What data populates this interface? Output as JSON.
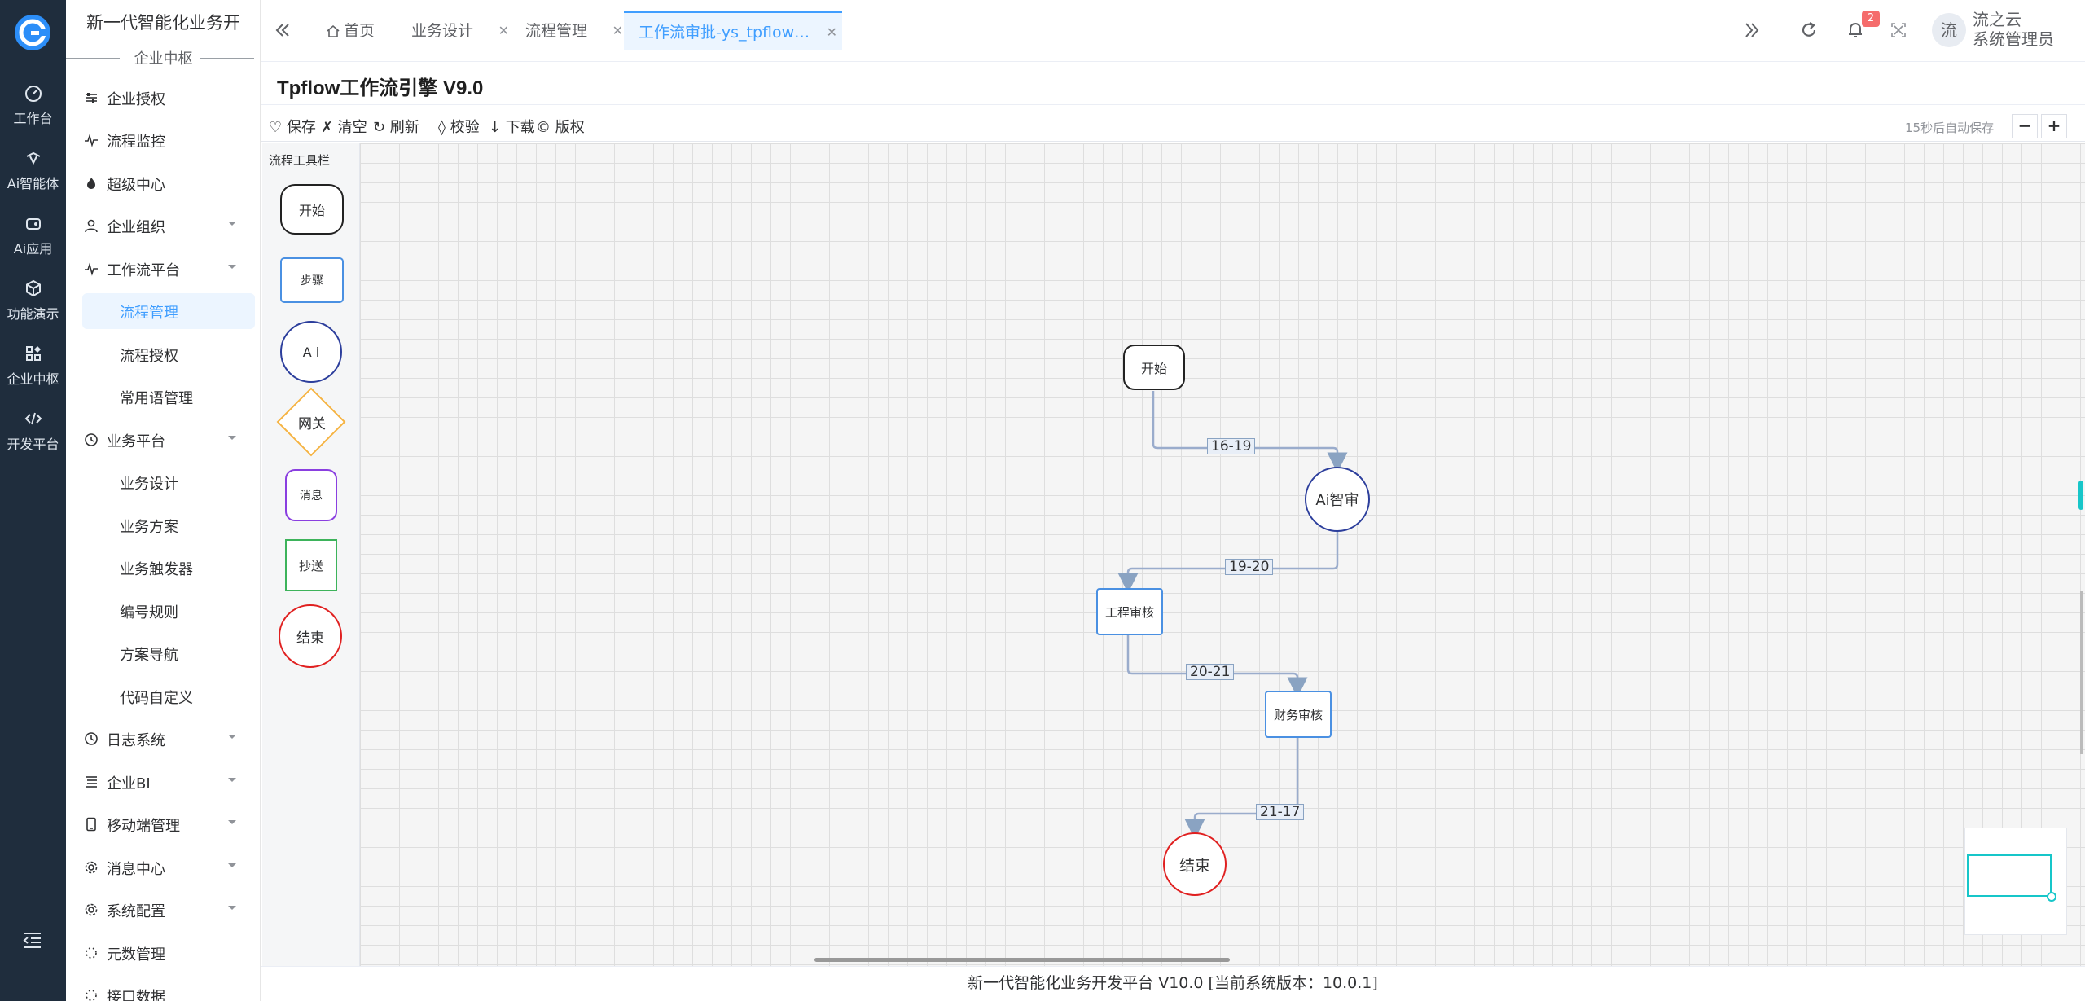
{
  "app": {
    "title": "新一代智能化业务开",
    "subtitle": "企业中枢"
  },
  "rail": {
    "items": [
      {
        "label": "工作台",
        "icon": "dashboard-icon"
      },
      {
        "label": "Ai智能体",
        "icon": "ai-agent-icon"
      },
      {
        "label": "Ai应用",
        "icon": "ai-app-icon"
      },
      {
        "label": "功能演示",
        "icon": "cube-icon"
      },
      {
        "label": "企业中枢",
        "icon": "grid-icon"
      },
      {
        "label": "开发平台",
        "icon": "code-icon"
      }
    ]
  },
  "menu": {
    "items": [
      {
        "label": "企业授权",
        "icon": "sliders-icon"
      },
      {
        "label": "流程监控",
        "icon": "pulse-icon"
      },
      {
        "label": "超级中心",
        "icon": "fire-icon"
      },
      {
        "label": "企业组织",
        "icon": "user-icon"
      },
      {
        "label": "工作流平台",
        "icon": "pulse-icon"
      },
      {
        "label": "流程管理"
      },
      {
        "label": "流程授权"
      },
      {
        "label": "常用语管理"
      },
      {
        "label": "业务平台",
        "icon": "clock-icon"
      },
      {
        "label": "业务设计"
      },
      {
        "label": "业务方案"
      },
      {
        "label": "业务触发器"
      },
      {
        "label": "编号规则"
      },
      {
        "label": "方案导航"
      },
      {
        "label": "代码自定义"
      },
      {
        "label": "日志系统",
        "icon": "clock-icon"
      },
      {
        "label": "企业BI",
        "icon": "list-icon"
      },
      {
        "label": "移动端管理",
        "icon": "phone-icon"
      },
      {
        "label": "消息中心",
        "icon": "gear-icon"
      },
      {
        "label": "系统配置",
        "icon": "gear-icon"
      },
      {
        "label": "元数管理",
        "icon": "spinner-icon"
      },
      {
        "label": "接口数据",
        "icon": "spinner-icon"
      }
    ]
  },
  "tabs": [
    {
      "label": "首页"
    },
    {
      "label": "业务设计"
    },
    {
      "label": "流程管理"
    },
    {
      "label": "工作流审批-ys_tpflow…"
    }
  ],
  "header": {
    "notification_count": "2",
    "avatar_text": "流",
    "user_line1": "流之云",
    "user_line2": "系统管理员"
  },
  "page": {
    "title": "Tpflow工作流引擎 V9.0",
    "autosave": "15秒后自动保存"
  },
  "toolbar": {
    "save": "♡ 保存",
    "clear": "✗ 清空",
    "refresh": "↻ 刷新",
    "validate": "◊ 校验",
    "download": "↓ 下载",
    "copyright": "© 版权",
    "zoom_out": "−",
    "zoom_in": "+"
  },
  "palette": {
    "title": "流程工具栏",
    "items": [
      "开始",
      "步骤",
      "A i",
      "网关",
      "消息",
      "抄送",
      "结束"
    ]
  },
  "flow": {
    "nodes": {
      "start": "开始",
      "ai": "Ai智审",
      "eng": "工程审核",
      "fin": "财务审核",
      "end": "结束"
    },
    "edges": [
      "16-19",
      "19-20",
      "20-21",
      "21-17"
    ]
  },
  "footer": "新一代智能化业务开发平台 V10.0 [当前系统版本：10.0.1]",
  "colors": {
    "rail_bg": "#1f2d3d",
    "accent": "#409eff",
    "start_border": "#222222",
    "step_border": "#4a90e2",
    "ai_border": "#2c3e9c",
    "gateway_border": "#f5b342",
    "message_border": "#8a3fe0",
    "cc_border": "#3db35b",
    "end_border": "#e02020"
  }
}
